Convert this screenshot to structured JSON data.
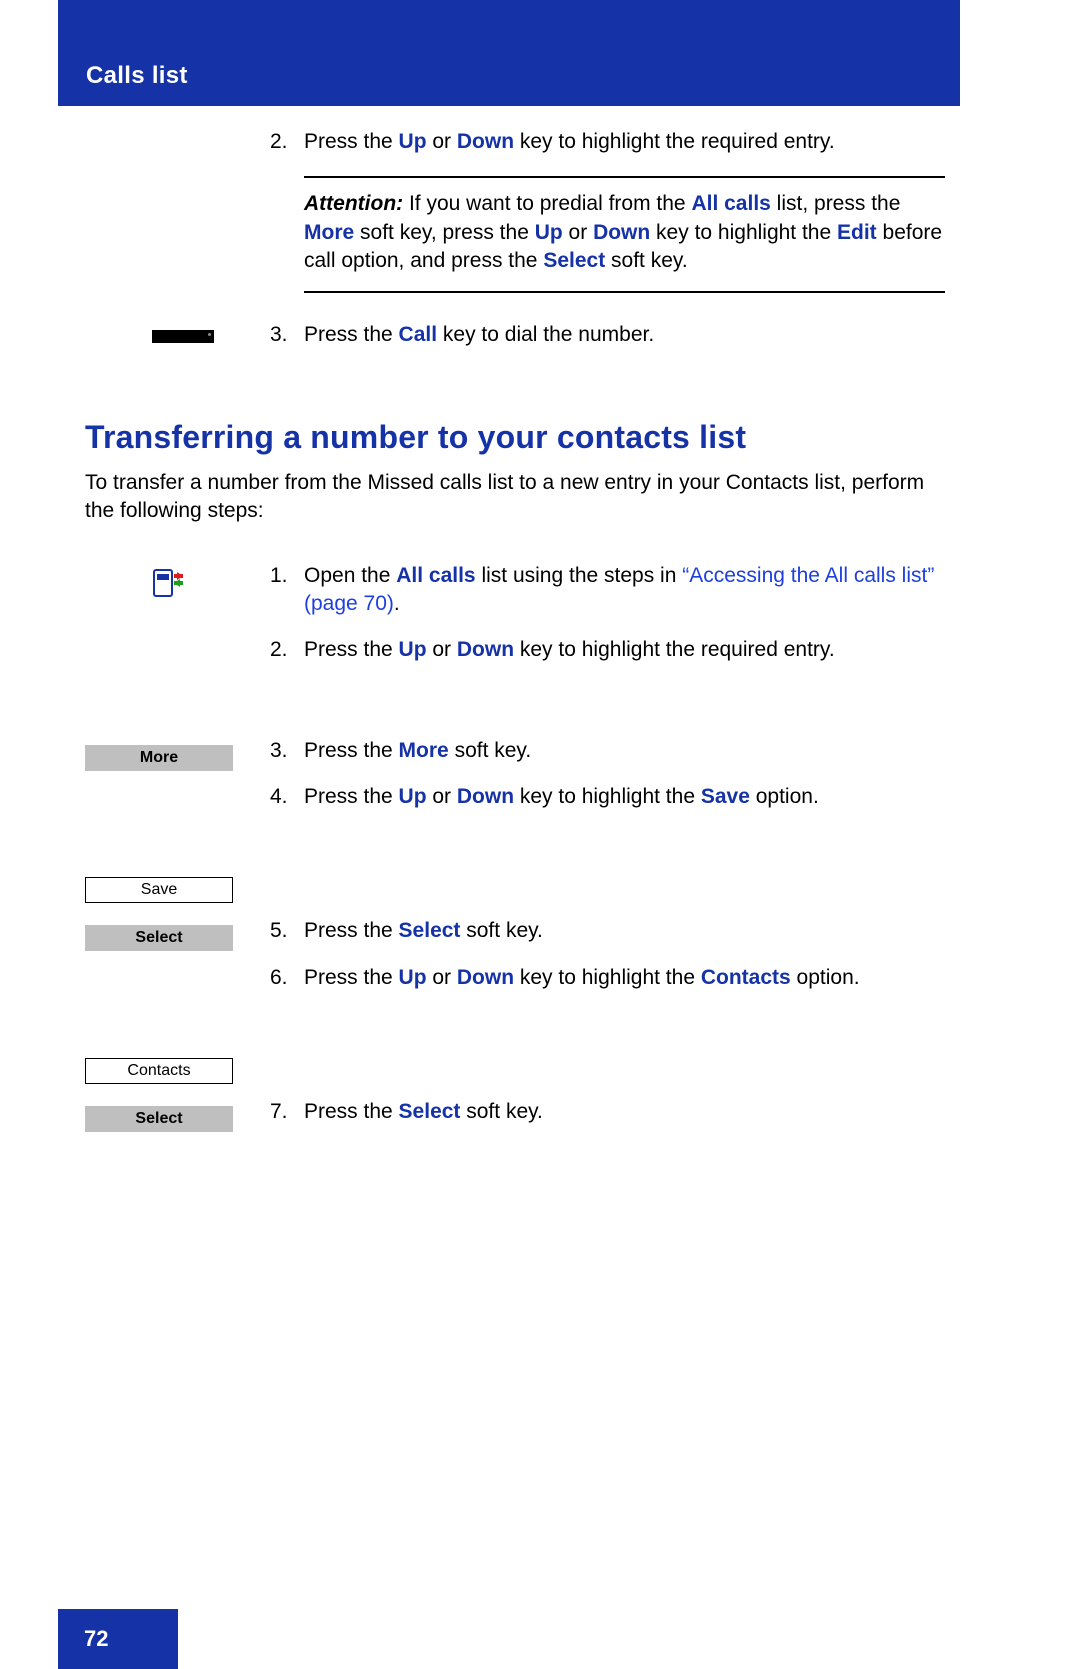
{
  "header": {
    "title": "Calls list"
  },
  "page_number": "72",
  "section1": {
    "step2": {
      "num": "2.",
      "parts": [
        "Press the ",
        "Up",
        " or ",
        "Down",
        " key to highlight the required entry."
      ]
    },
    "attention": {
      "label": "Attention:",
      "p1a": " If you want to predial from the ",
      "p1b": "All calls",
      "p2a": " list, press the ",
      "p2b": "More",
      "p3a": " soft key, press the ",
      "p3b": "Up",
      "p3c": " or ",
      "p3d": "Down",
      "p4a": " key to highlight the ",
      "p4b": "Edit",
      "p4c": " before call option, and press the ",
      "p4d": "Select",
      "p4e": " soft key."
    },
    "step3": {
      "num": "3.",
      "a": "Press the ",
      "b": "Call",
      "c": " key to dial the number."
    }
  },
  "section2": {
    "title": "Transferring a number to your contacts list",
    "intro": "To transfer a number from the Missed calls list to a new entry in your Contacts list, perform the following steps:",
    "step1": {
      "num": "1.",
      "a": "Open the ",
      "b": "All calls",
      "c": " list using the steps in ",
      "link": "“Accessing the All calls list” (page 70)",
      "d": "."
    },
    "step2": {
      "num": "2.",
      "a": "Press the ",
      "b": "Up",
      "c": " or ",
      "d": "Down",
      "e": " key to highlight the required entry."
    },
    "step3": {
      "num": "3.",
      "a": "Press the ",
      "b": "More",
      "c": " soft key."
    },
    "step4": {
      "num": "4.",
      "a": "Press the ",
      "b": "Up",
      "c": " or ",
      "d": "Down",
      "e": " key to highlight the ",
      "f": "Save",
      "g": " option."
    },
    "step5": {
      "num": "5.",
      "a": "Press the ",
      "b": "Select",
      "c": " soft key."
    },
    "step6": {
      "num": "6.",
      "a": "Press the ",
      "b": "Up",
      "c": " or ",
      "d": "Down",
      "e": " key to highlight the ",
      "f": "Contacts",
      "g": " option."
    },
    "step7": {
      "num": "7.",
      "a": "Press the ",
      "b": "Select",
      "c": " soft key."
    },
    "softkeys": {
      "more": "More",
      "save": "Save",
      "select1": "Select",
      "contacts": "Contacts",
      "select2": "Select"
    }
  }
}
